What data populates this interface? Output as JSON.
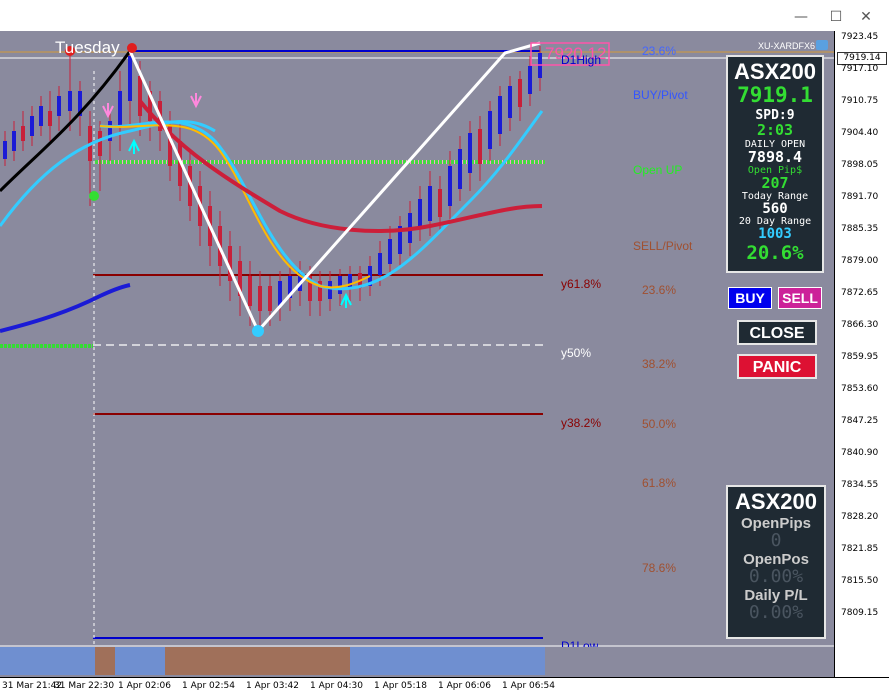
{
  "window": {
    "symbol_badge": "XU-XARDFX6"
  },
  "chart": {
    "day_label": "Tuesday",
    "current_price_box": "7919.14",
    "top_price_label": "7920.12",
    "d1high_label": "D1High",
    "d1low_label": "D1Low",
    "level_labels": {
      "buy_pivot": "BUY/Pivot",
      "open_up": "Open UP",
      "sell_pivot": "SELL/Pivot",
      "y618": "y61.8%",
      "y50": "y50%",
      "y382": "y38.2%"
    },
    "fib_labels": [
      "23.6%",
      "23.6%",
      "38.2%",
      "50.0%",
      "61.8%",
      "78.6%"
    ]
  },
  "y_axis": {
    "ticks": [
      "7923.45",
      "7917.10",
      "7910.75",
      "7904.40",
      "7898.05",
      "7891.70",
      "7885.35",
      "7879.00",
      "7872.65",
      "7866.30",
      "7859.95",
      "7853.60",
      "7847.25",
      "7840.90",
      "7834.55",
      "7828.20",
      "7821.85",
      "7815.50",
      "7809.15"
    ]
  },
  "x_axis": {
    "ticks": [
      "31 Mar 21:42",
      "31 Mar 22:30",
      "1 Apr 02:06",
      "1 Apr 02:54",
      "1 Apr 03:42",
      "1 Apr 04:30",
      "1 Apr 05:18",
      "1 Apr 06:06",
      "1 Apr 06:54"
    ]
  },
  "info_panel": {
    "symbol": "ASX200",
    "price": "7919.1",
    "spread": "SPD:9",
    "timer": "2:03",
    "daily_open_label": "DAILY OPEN",
    "daily_open_value": "7898.4",
    "open_pips_label": "Open Pip$",
    "open_pips_value": "207",
    "today_range_label": "Today Range",
    "today_range_value": "560",
    "twenty_day_label": "20 Day Range",
    "twenty_day_value": "1003",
    "percent": "20.6%"
  },
  "buttons": {
    "buy": "BUY",
    "sell": "SELL",
    "close": "CLOSE",
    "panic": "PANIC"
  },
  "stats_panel": {
    "symbol": "ASX200",
    "open_pips_label": "OpenPips",
    "open_pips_value": "0",
    "open_pos_label": "OpenPos",
    "open_pos_value": "0.00%",
    "daily_pl_label": "Daily P/L",
    "daily_pl_value": "0.00%"
  },
  "colors": {
    "chart_bg": "#8a8a9e",
    "bull_candle": "#1b1bd6",
    "bear_candle": "#c8203a",
    "panel_bg": "#1f2a33",
    "accent_green": "#33dd33",
    "accent_cyan": "#33ccff"
  }
}
